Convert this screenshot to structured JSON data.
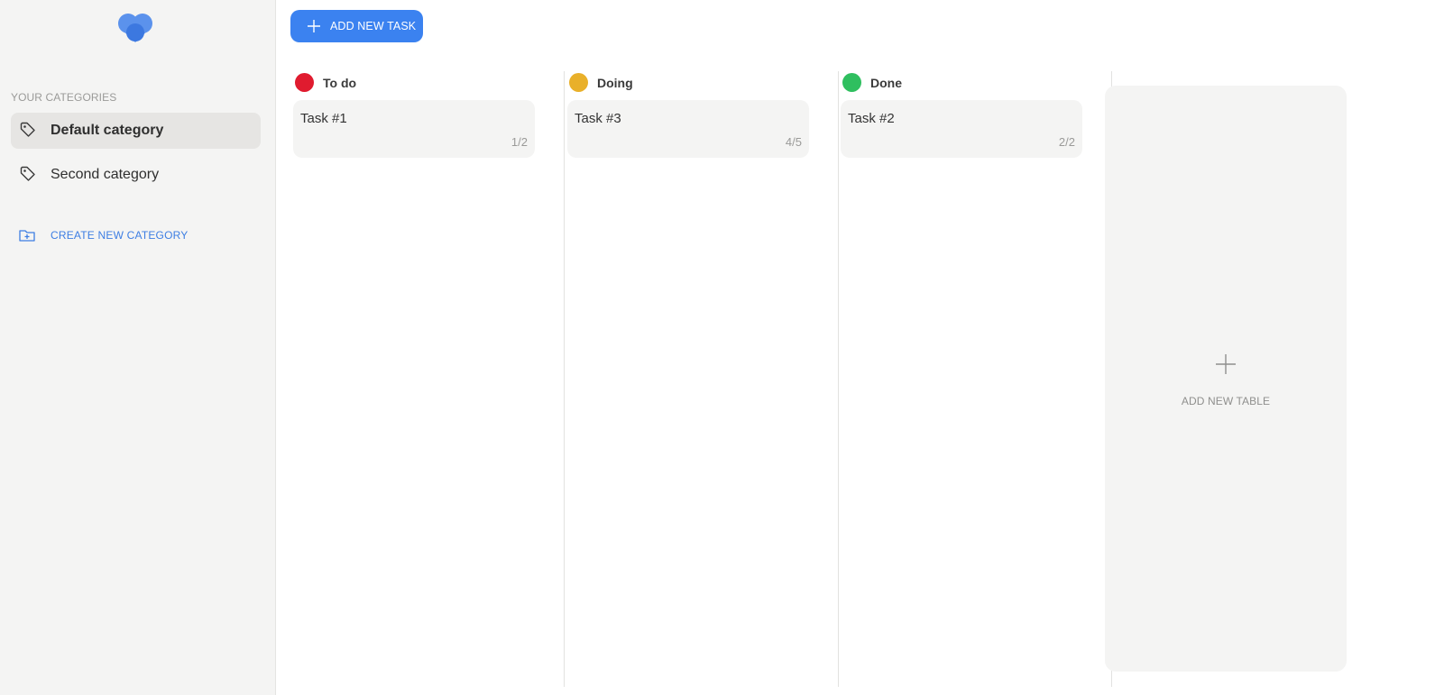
{
  "sidebar": {
    "logo_icon": "heart-logo-icon",
    "section_title": "YOUR CATEGORIES",
    "categories": [
      {
        "label": "Default category",
        "icon": "tag-icon",
        "active": true
      },
      {
        "label": "Second category",
        "icon": "tag-icon",
        "active": false
      }
    ],
    "create_label": "CREATE NEW CATEGORY",
    "create_icon": "folder-plus-icon"
  },
  "toolbar": {
    "add_task_label": "ADD NEW TASK",
    "add_task_icon": "plus-icon"
  },
  "columns": [
    {
      "title": "To do",
      "color": "#e01b2f",
      "tasks": [
        {
          "title": "Task #1",
          "progress": "1/2"
        }
      ]
    },
    {
      "title": "Doing",
      "color": "#e9b02a",
      "tasks": [
        {
          "title": "Task #3",
          "progress": "4/5"
        }
      ]
    },
    {
      "title": "Done",
      "color": "#2fbf5f",
      "tasks": [
        {
          "title": "Task #2",
          "progress": "2/2"
        }
      ]
    }
  ],
  "add_table": {
    "label": "ADD NEW TABLE",
    "icon": "plus-icon"
  },
  "colors": {
    "accent": "#3b82f0",
    "link": "#3d7ee3",
    "sidebar_bg": "#f4f4f3",
    "card_bg": "#f4f4f3"
  }
}
